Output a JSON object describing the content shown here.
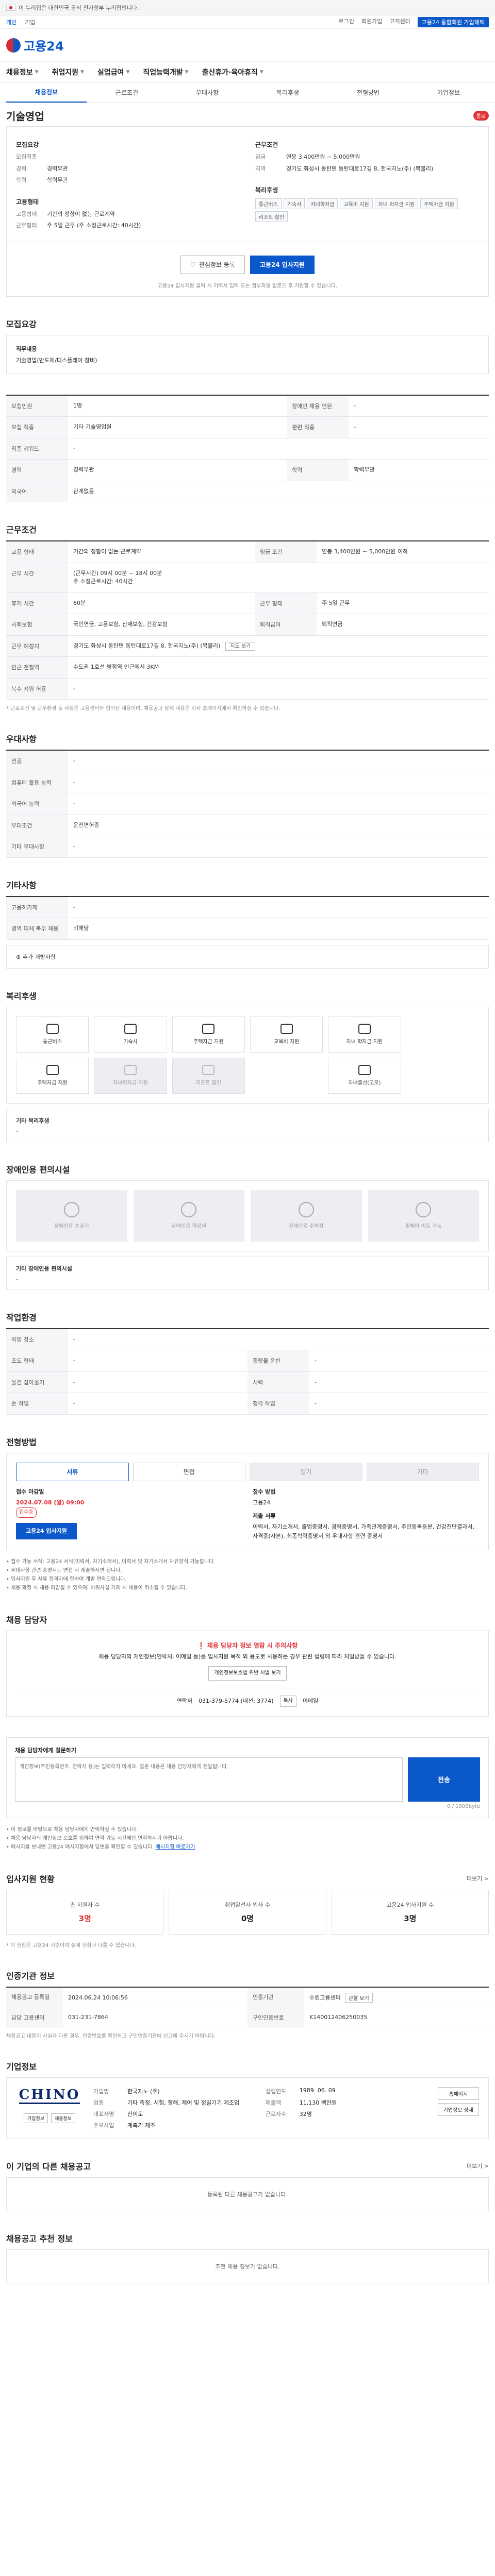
{
  "gov_banner": "이 누리집은 대한민국 공식 전자정부 누리집입니다.",
  "util": {
    "left": [
      "개인",
      "기업"
    ],
    "right": [
      "로그인",
      "회원가입",
      "고객센터"
    ],
    "member": "고용24 통합회원 가입혜택"
  },
  "logo": "고용24",
  "gnb": [
    "채용정보",
    "취업지원",
    "실업급여",
    "직업능력개발",
    "출산휴가·육아휴직"
  ],
  "sub_tabs": [
    "채용정보",
    "근로조건",
    "우대사항",
    "복리후생",
    "전형방법",
    "기업정보"
  ],
  "job": {
    "title": "기술영업",
    "badge": "통보",
    "recruit_head": "모집요강",
    "recruit": [
      {
        "k": "모집직종",
        "v": ""
      },
      {
        "k": "경력",
        "v": "경력무관"
      },
      {
        "k": "학력",
        "v": "학력무관"
      }
    ],
    "cond_head": "근무조건",
    "cond": [
      {
        "k": "임금",
        "v": "연봉 3,400만원 ~ 5,000만원"
      },
      {
        "k": "지역",
        "v": "경기도 화성시 동탄면 동탄대로17길 8, 한국지노(주) (북불리)"
      }
    ],
    "type_head": "고용형태",
    "type": [
      {
        "k": "고용형태",
        "v": "기간의 정함이 없는 근로계약"
      },
      {
        "k": "근무형태",
        "v": "주 5일 근무 (주 소정근로시간: 40시간)"
      }
    ],
    "welfare_head": "복리후생",
    "welfare": [
      "통근버스",
      "기숙사",
      "자녀학자금",
      "교육비 지원",
      "자녀 학자금 지원",
      "주택자금 지원",
      "리조트 할인"
    ]
  },
  "actions": {
    "scrap": "관심정보 등록",
    "apply": "고용24 입사지원",
    "note": "고용24 입사지원 클릭 시 이력서 입력 또는 첨부파일 업로드 후 지원할 수 있습니다."
  },
  "recruit_sec": {
    "title": "모집요강",
    "task_head": "직무내용",
    "task": "기술영업(반도체/디스플레이 장비)"
  },
  "qual": {
    "rows": [
      [
        "모집인원",
        "1명",
        "장애인 채용 인원",
        "-"
      ],
      [
        "모집 직종",
        "기타 기술영업원",
        "관련 직종",
        "-"
      ],
      [
        "직종 키워드",
        "-",
        "",
        ""
      ],
      [
        "경력",
        "경력무관",
        "학력",
        "학력무관"
      ],
      [
        "외국어",
        "관계없음",
        "",
        ""
      ]
    ]
  },
  "work": {
    "title": "근무조건",
    "rows": [
      {
        "k": "고용 형태",
        "v": "기간의 정함이 없는 근로계약",
        "k2": "임금 조건",
        "v2": "연봉 3,400만원 ~ 5,000만원 이하"
      },
      {
        "k": "근무 시간",
        "v": "(근무시간) 09시 00분 ~ 18시 00분\n주 소정근로시간: 40시간",
        "k2": "",
        "v2": ""
      },
      {
        "k": "휴게 시간",
        "v": "60분",
        "k2": "근무 형태",
        "v2": "주 5일 근무"
      },
      {
        "k": "사회보험",
        "v": "국민연금, 고용보험, 산재보험, 건강보험",
        "k2": "퇴직급여",
        "v2": "퇴직연금"
      },
      {
        "k": "근무 예정지",
        "v": "경기도 화성시 동탄면 동탄대로17길 8, 한국지노(주) (북불리)",
        "k2": "",
        "v2": ""
      },
      {
        "k": "인근 전철역",
        "v": "수도권 1호선 병점역 인근에서 3KM",
        "k2": "",
        "v2": ""
      },
      {
        "k": "복수 지원 허용",
        "v": "-",
        "k2": "",
        "v2": ""
      }
    ],
    "map_btn": "지도 보기",
    "note": "* 근로조건 및 근무환경 등 사항은 고용센터와 협의된 내용이며, 채용공고 상세 내용은 회사 홈페이지에서 확인하실 수 있습니다."
  },
  "pref": {
    "title": "우대사항",
    "rows": [
      [
        "전공",
        "-"
      ],
      [
        "컴퓨터 활용 능력",
        "-"
      ],
      [
        "외국어 능력",
        "-"
      ],
      [
        "우대조건",
        "운전면허증"
      ],
      [
        "기타 우대사항",
        "-"
      ]
    ]
  },
  "etc": {
    "title": "기타사항",
    "rows": [
      [
        "고용허가제",
        "-"
      ],
      [
        "병역 대체 복무 채용",
        "비해당"
      ]
    ],
    "extra": "추가 개방사항"
  },
  "benefit": {
    "title": "복리후생",
    "tiles": [
      {
        "label": "통근버스",
        "icon": "bus-icon",
        "dim": false
      },
      {
        "label": "기숙사",
        "icon": "dorm-icon",
        "dim": false
      },
      {
        "label": "주택자금 지원",
        "icon": "house-icon",
        "dim": false
      },
      {
        "label": "교육비 지원",
        "icon": "book-icon",
        "dim": false
      },
      {
        "label": "자녀 학자금 지원",
        "icon": "cap-icon",
        "dim": false
      },
      {
        "label": "",
        "icon": "blank-icon",
        "dim": false
      },
      {
        "label": "주택자금 지원",
        "icon": "house-icon",
        "dim": false
      },
      {
        "label": "자녀학자금 지원",
        "icon": "cap-icon",
        "dim": true
      },
      {
        "label": "리조트 할인",
        "icon": "resort-icon",
        "dim": true
      },
      {
        "label": "",
        "icon": "blank-icon",
        "dim": false
      },
      {
        "label": "자녀출산(고모)",
        "icon": "baby-icon",
        "dim": false
      },
      {
        "label": "",
        "icon": "blank-icon",
        "dim": false
      }
    ],
    "other_head": "기타 복리후생",
    "other": "-"
  },
  "disabled": {
    "title": "장애인용 편의시설",
    "tiles": [
      "장애인용 승강기",
      "장애인용 화장실",
      "장애인용 주차장",
      "휠체어 이동 가능"
    ],
    "other_head": "기타 장애인용 편의시설",
    "other": "-"
  },
  "env": {
    "title": "작업환경",
    "rows": [
      [
        "작업 장소",
        "-",
        "",
        ""
      ],
      [
        "조도 형태",
        "-",
        "중량물 운반",
        "-"
      ],
      [
        "물건 잡아옮기",
        "-",
        "시력",
        "-"
      ],
      [
        "손 작업",
        "-",
        "청각 작업",
        "-"
      ]
    ]
  },
  "process": {
    "title": "전형방법",
    "tabs": [
      "서류",
      "면접",
      "필기",
      "기타"
    ],
    "deadline_head": "접수 마감일",
    "deadline": "2024.07.08 (월) 09:00",
    "deadline_tag": "접수중",
    "method_head": "접수 방법",
    "method": "고용24",
    "docs_head": "제출 서류",
    "docs": "이력서, 자기소개서, 졸업증명서, 경력증명서, 가족관계증명서, 주민등록등본, 건강진단결과서, 자격증(사본), 최종학력증명서 외 우대사항 관련 증명서",
    "apply_btn": "고용24 입사지원",
    "notes": [
      "접수 가능 서식: 고용24 서식(이력서, 자기소개서), 이력서 및 자기소개서 자유양식 가능합니다.",
      "우대사항 관련 증명서는 면접 시 제출하시면 됩니다.",
      "입사지원 후 서류 합격자에 한하여 개별 연락드립니다.",
      "채용 확정 시 채용 마감될 수 있으며, 허위사실 기재 시 채용이 취소될 수 있습니다."
    ]
  },
  "manager": {
    "title": "채용 담당자",
    "warn": "채용 담당자 정보 열람 시 주의사항",
    "text": "채용 담당자의 개인정보(연락처, 이메일 등)를 입사지원 목적 외 용도로 사용하는 경우 관련 법령에 따라 처벌받을 수 있습니다.",
    "btn": "개인정보보호법 위반 처벌 보기",
    "phone_label": "연락처",
    "phone": "031-379-5774 (내선: 3774)",
    "copy": "복사",
    "fax_label": "이메일"
  },
  "message": {
    "title": "채용 담당자에게 메시지",
    "label": "채용 담당자에게 질문하기",
    "placeholder": "개인정보(주민등록번호, 연락처 등)는 입력하지 마세요. 질문 내용은 채용 담당자에게 전달됩니다.",
    "send": "전송",
    "counter": "0 / 1000byte",
    "notes": [
      "이 정보를 바탕으로 채용 담당자에게 연락하실 수 있습니다.",
      "채용 담당자의 개인정보 보호를 위하여 연락 가능 시간에만 연락하시기 바랍니다.",
      "메시지를 보내면 고용24 메시지함에서 답변을 확인할 수 있습니다."
    ],
    "link": "메시지함 바로가기"
  },
  "apply_status": {
    "title": "입사지원 현황",
    "more": "더보기 >",
    "stats": [
      {
        "label": "총 지원자 수",
        "value": "3명"
      },
      {
        "label": "취업알선자 입사 수",
        "value": "0명"
      },
      {
        "label": "고용24 입사지원 수",
        "value": "3명"
      }
    ],
    "note": "* 이 현황은 고용24 기준이며 실제 현황과 다를 수 있습니다."
  },
  "cert": {
    "title": "인증기관 정보",
    "rows": [
      [
        "채용공고 등록일",
        "2024.06.24 10:06:56",
        "인증기관",
        "수원고용센터"
      ],
      [
        "담당 고용센터",
        "031-231-7864",
        "구인인증번호",
        "K140012406250035"
      ]
    ],
    "btn": "관할 보기",
    "note": "채용공고 내용이 사실과 다른 경우, 인증번호를 확인하고 구인인증기관에 신고해 주시기 바랍니다."
  },
  "company": {
    "title": "기업정보",
    "logo": "CHINO",
    "mini": [
      "기업정보",
      "채용정보"
    ],
    "info": [
      [
        "기업명",
        "한국지노 (주)"
      ],
      [
        "설립연도",
        "1989. 06. 09"
      ],
      [
        "업종",
        "기타 측정, 시험, 항해, 제어 및 정밀기기 제조업"
      ],
      [
        "매출액",
        "11,130 백만원"
      ],
      [
        "대표자명",
        "찬이토"
      ],
      [
        "근로자수",
        "32명"
      ],
      [
        "주요사업",
        "계측기 제조"
      ]
    ],
    "btns": [
      "홈페이지",
      "기업정보 상세"
    ]
  },
  "other_jobs": {
    "title": "이 기업의 다른 채용공고",
    "more": "더보기 >",
    "empty": "등록된 다른 채용공고가 없습니다."
  },
  "recommend": {
    "title": "채용공고 추천 정보",
    "empty": "추천 채용 정보가 없습니다."
  }
}
